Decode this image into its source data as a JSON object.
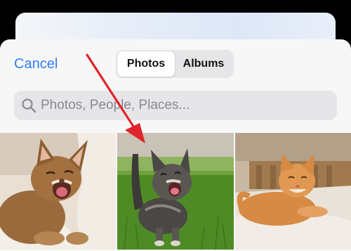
{
  "header": {
    "cancel_label": "Cancel",
    "tabs": [
      {
        "label": "Photos",
        "selected": true
      },
      {
        "label": "Albums",
        "selected": false
      }
    ]
  },
  "search": {
    "placeholder": "Photos, People, Places...",
    "value": "",
    "icon": "search-icon"
  },
  "photos": [
    {
      "subject": "Abyssinian cat lying on a white cushion, yawning"
    },
    {
      "subject": "Tabby kitten standing in green grass, meowing"
    },
    {
      "subject": "Orange tabby cat lying on a bed"
    }
  ],
  "colors": {
    "accent": "#2f7cf6",
    "annotation_arrow": "#e0242b"
  }
}
